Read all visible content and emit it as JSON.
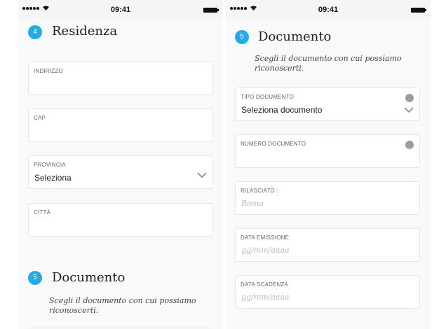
{
  "left": {
    "status": {
      "time": "09:41"
    },
    "residenza": {
      "step": "4",
      "title": "Residenza",
      "fields": {
        "indirizzo": {
          "label": "INDIRIZZO",
          "value": ""
        },
        "cap": {
          "label": "CAP",
          "value": ""
        },
        "provincia": {
          "label": "PROVINCIA",
          "value": "Seleziona"
        },
        "citta": {
          "label": "CITTÀ",
          "value": ""
        }
      }
    },
    "documento": {
      "step": "5",
      "title": "Documento",
      "subtitle_line1": "Scegli il documento con cui possiamo",
      "subtitle_line2": "riconoscerti."
    }
  },
  "right": {
    "status": {
      "time": "09:41"
    },
    "documento": {
      "step": "5",
      "title": "Documento",
      "subtitle_line1": "Scegli il documento con cui possiamo",
      "subtitle_line2": "riconoscerti.",
      "fields": {
        "tipo": {
          "label": "TIPO DOCUMENTO",
          "value": "Seleziona documento"
        },
        "numero": {
          "label": "NUMERO DOCUMENTO",
          "value": ""
        },
        "rilasciato": {
          "label": "RILASCIATO :",
          "placeholder": "Roma"
        },
        "emissione": {
          "label": "DATA EMISSIONE",
          "placeholder": "gg/mm/aaaa"
        },
        "scadenza": {
          "label": "DATA SCADENZA",
          "placeholder": "gg/mm/aaaa"
        }
      }
    }
  },
  "colors": {
    "accent": "#29a9e1",
    "background": "#f7f9fa",
    "border": "#e3e6e9"
  },
  "icons": {
    "dropdown": "chevron-down-icon",
    "info": "info-icon"
  }
}
